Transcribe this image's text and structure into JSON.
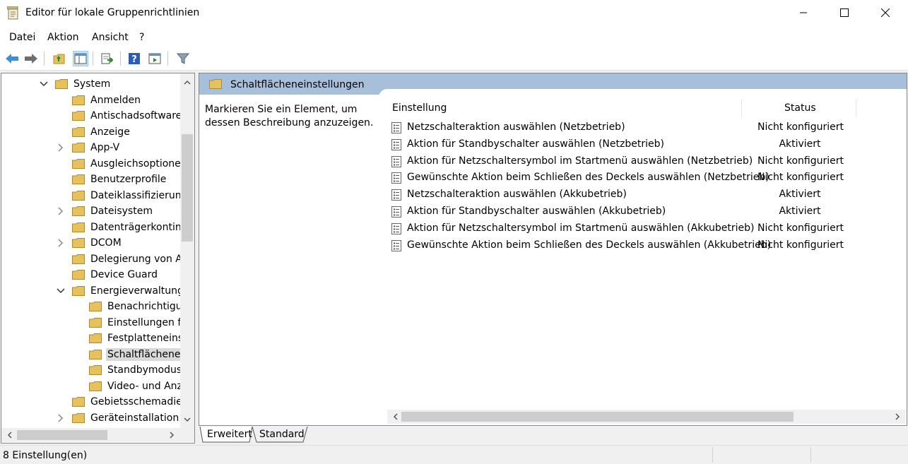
{
  "window": {
    "title": "Editor für lokale Gruppenrichtlinien"
  },
  "menu": {
    "items": [
      "Datei",
      "Aktion",
      "Ansicht",
      "?"
    ]
  },
  "tree": {
    "items": [
      {
        "label": "System",
        "expanded": true,
        "level": 1
      },
      {
        "label": "Anmelden",
        "level": 2
      },
      {
        "label": "Antischadsoftware-",
        "level": 2
      },
      {
        "label": "Anzeige",
        "level": 2
      },
      {
        "label": "App-V",
        "level": 2,
        "collapsed": true
      },
      {
        "label": "Ausgleichsoptionen",
        "level": 2
      },
      {
        "label": "Benutzerprofile",
        "level": 2
      },
      {
        "label": "Dateiklassifizierung",
        "level": 2
      },
      {
        "label": "Dateisystem",
        "level": 2,
        "collapsed": true
      },
      {
        "label": "Datenträgerkontingente",
        "level": 2
      },
      {
        "label": "DCOM",
        "level": 2,
        "collapsed": true
      },
      {
        "label": "Delegierung von Anmeldeinformationen",
        "level": 2
      },
      {
        "label": "Device Guard",
        "level": 2
      },
      {
        "label": "Energieverwaltung",
        "level": 2,
        "expanded": true
      },
      {
        "label": "Benachrichtigungseinstellungen",
        "level": 3
      },
      {
        "label": "Einstellungen für",
        "level": 3
      },
      {
        "label": "Festplatteneinstellungen",
        "level": 3
      },
      {
        "label": "Schaltflächeneinstellungen",
        "level": 3,
        "selected": true
      },
      {
        "label": "Standbymodus-Einstellungen",
        "level": 3
      },
      {
        "label": "Video- und Anzeigeeinstellungen",
        "level": 3
      },
      {
        "label": "Gebietsschemadienste",
        "level": 2
      },
      {
        "label": "Geräteinstallation",
        "level": 2,
        "collapsed": true
      }
    ]
  },
  "details": {
    "header": "Schaltflächeneinstellungen",
    "description": "Markieren Sie ein Element, um dessen Beschreibung anzuzeigen.",
    "columns": {
      "setting": "Einstellung",
      "status": "Status"
    },
    "rows": [
      {
        "name": "Netzschalteraktion auswählen (Netzbetrieb)",
        "status": "Nicht konfiguriert"
      },
      {
        "name": "Aktion für Standbyschalter auswählen (Netzbetrieb)",
        "status": "Aktiviert"
      },
      {
        "name": "Aktion für Netzschaltersymbol im Startmenü auswählen (Netzbetrieb)",
        "status": "Nicht konfiguriert"
      },
      {
        "name": "Gewünschte Aktion beim Schließen des Deckels auswählen (Netzbetrieb)",
        "status": "Nicht konfiguriert"
      },
      {
        "name": "Netzschalteraktion auswählen (Akkubetrieb)",
        "status": "Aktiviert"
      },
      {
        "name": "Aktion für Standbyschalter auswählen (Akkubetrieb)",
        "status": "Aktiviert"
      },
      {
        "name": "Aktion für Netzschaltersymbol im Startmenü auswählen (Akkubetrieb)",
        "status": "Nicht konfiguriert"
      },
      {
        "name": "Gewünschte Aktion beim Schließen des Deckels auswählen (Akkubetrieb)",
        "status": "Nicht konfiguriert"
      }
    ]
  },
  "tabs": {
    "extended": "Erweitert",
    "standard": "Standard"
  },
  "statusbar": {
    "text": "8 Einstellung(en)"
  },
  "colors": {
    "header_band": "#a8bfd9",
    "folder": "#e8c15f",
    "selection": "#d9d9d9"
  },
  "icons": [
    "back-icon",
    "forward-icon",
    "up-folder-icon",
    "show-hide-tree-icon",
    "export-list-icon",
    "help-icon",
    "properties-icon",
    "filter-icon"
  ]
}
